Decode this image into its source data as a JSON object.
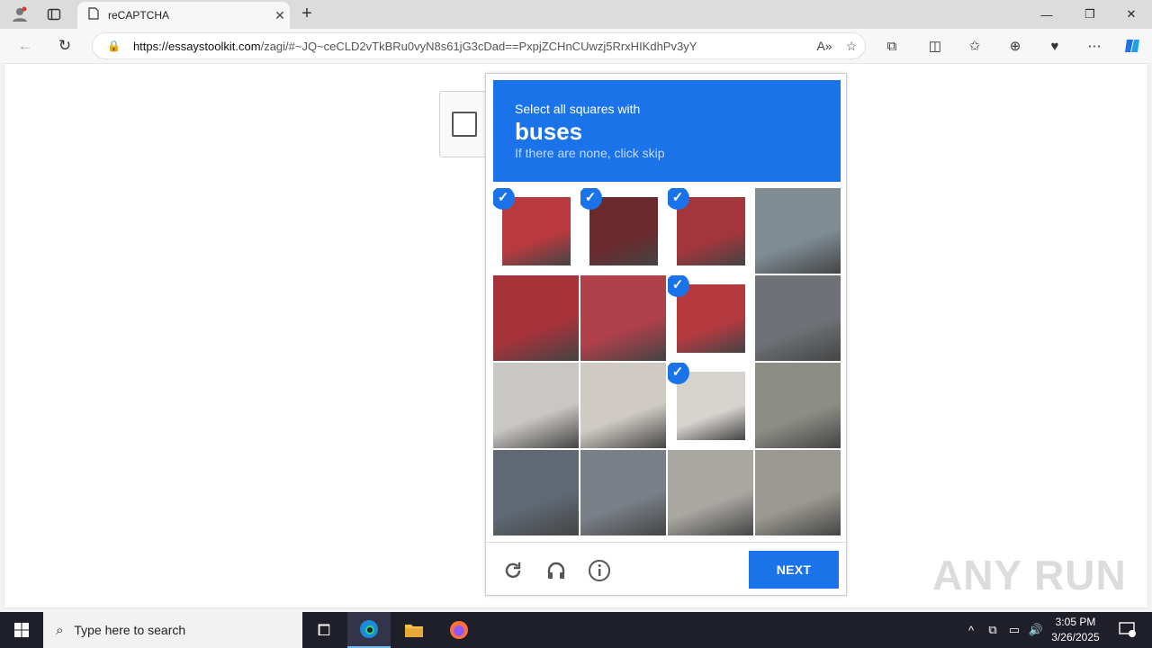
{
  "tab": {
    "title": "reCAPTCHA"
  },
  "address": {
    "url_domain": "https://essaystoolkit.com",
    "url_path": "/zagi/#~JQ~ceCLD2vTkBRu0vyN8s61jG3cDad==PxpjZCHnCUwzj5RrxHIKdhPv3yY"
  },
  "challenge": {
    "line1": "Select all squares with",
    "target": "buses",
    "line3": "If there are none, click skip",
    "next_label": "NEXT",
    "tiles": [
      {
        "row": 0,
        "col": 0,
        "selected": true,
        "color": "#b83a3f"
      },
      {
        "row": 0,
        "col": 1,
        "selected": true,
        "color": "#6b2a2e"
      },
      {
        "row": 0,
        "col": 2,
        "selected": true,
        "color": "#a3363c"
      },
      {
        "row": 0,
        "col": 3,
        "selected": false,
        "color": "#7f8c94"
      },
      {
        "row": 1,
        "col": 0,
        "selected": false,
        "color": "#a8323a"
      },
      {
        "row": 1,
        "col": 1,
        "selected": false,
        "color": "#b0404a"
      },
      {
        "row": 1,
        "col": 2,
        "selected": true,
        "color": "#b53a40"
      },
      {
        "row": 1,
        "col": 3,
        "selected": false,
        "color": "#6e7276"
      },
      {
        "row": 2,
        "col": 0,
        "selected": false,
        "color": "#c9c7c4"
      },
      {
        "row": 2,
        "col": 1,
        "selected": false,
        "color": "#cfcbc4"
      },
      {
        "row": 2,
        "col": 2,
        "selected": true,
        "color": "#d7d4d0"
      },
      {
        "row": 2,
        "col": 3,
        "selected": false,
        "color": "#8c8e86"
      },
      {
        "row": 3,
        "col": 0,
        "selected": false,
        "color": "#5f6873"
      },
      {
        "row": 3,
        "col": 1,
        "selected": false,
        "color": "#7a8088"
      },
      {
        "row": 3,
        "col": 2,
        "selected": false,
        "color": "#a9a7a2"
      },
      {
        "row": 3,
        "col": 3,
        "selected": false,
        "color": "#9a9890"
      }
    ]
  },
  "watermark": "ANY RUN",
  "taskbar": {
    "search_placeholder": "Type here to search",
    "time": "3:05 PM",
    "date": "3/26/2025"
  },
  "colors": {
    "accent": "#1a73e8"
  }
}
